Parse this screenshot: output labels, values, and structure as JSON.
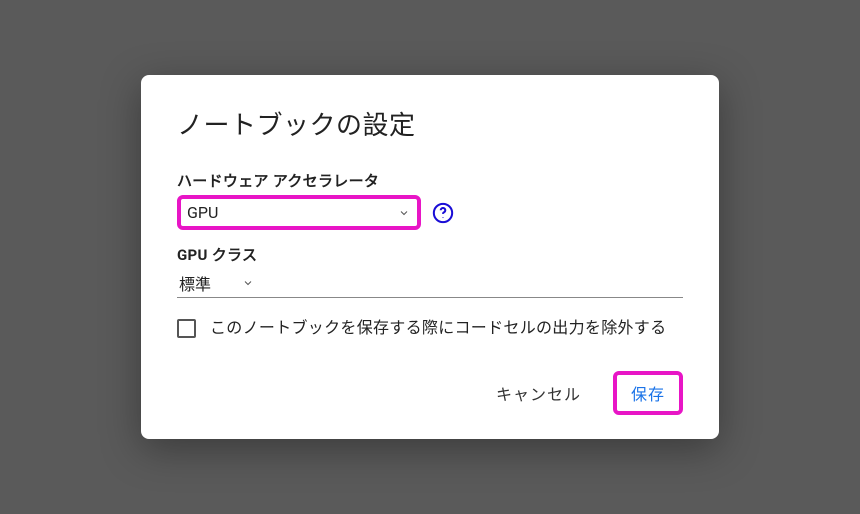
{
  "dialog": {
    "title": "ノートブックの設定",
    "accelerator": {
      "label": "ハードウェア アクセラレータ",
      "value": "GPU"
    },
    "gpuClass": {
      "label": "GPU クラス",
      "value": "標準"
    },
    "omitOutput": {
      "label": "このノートブックを保存する際にコードセルの出力を除外する",
      "checked": false
    },
    "buttons": {
      "cancel": "キャンセル",
      "save": "保存"
    }
  },
  "highlight_color": "#e815c6"
}
